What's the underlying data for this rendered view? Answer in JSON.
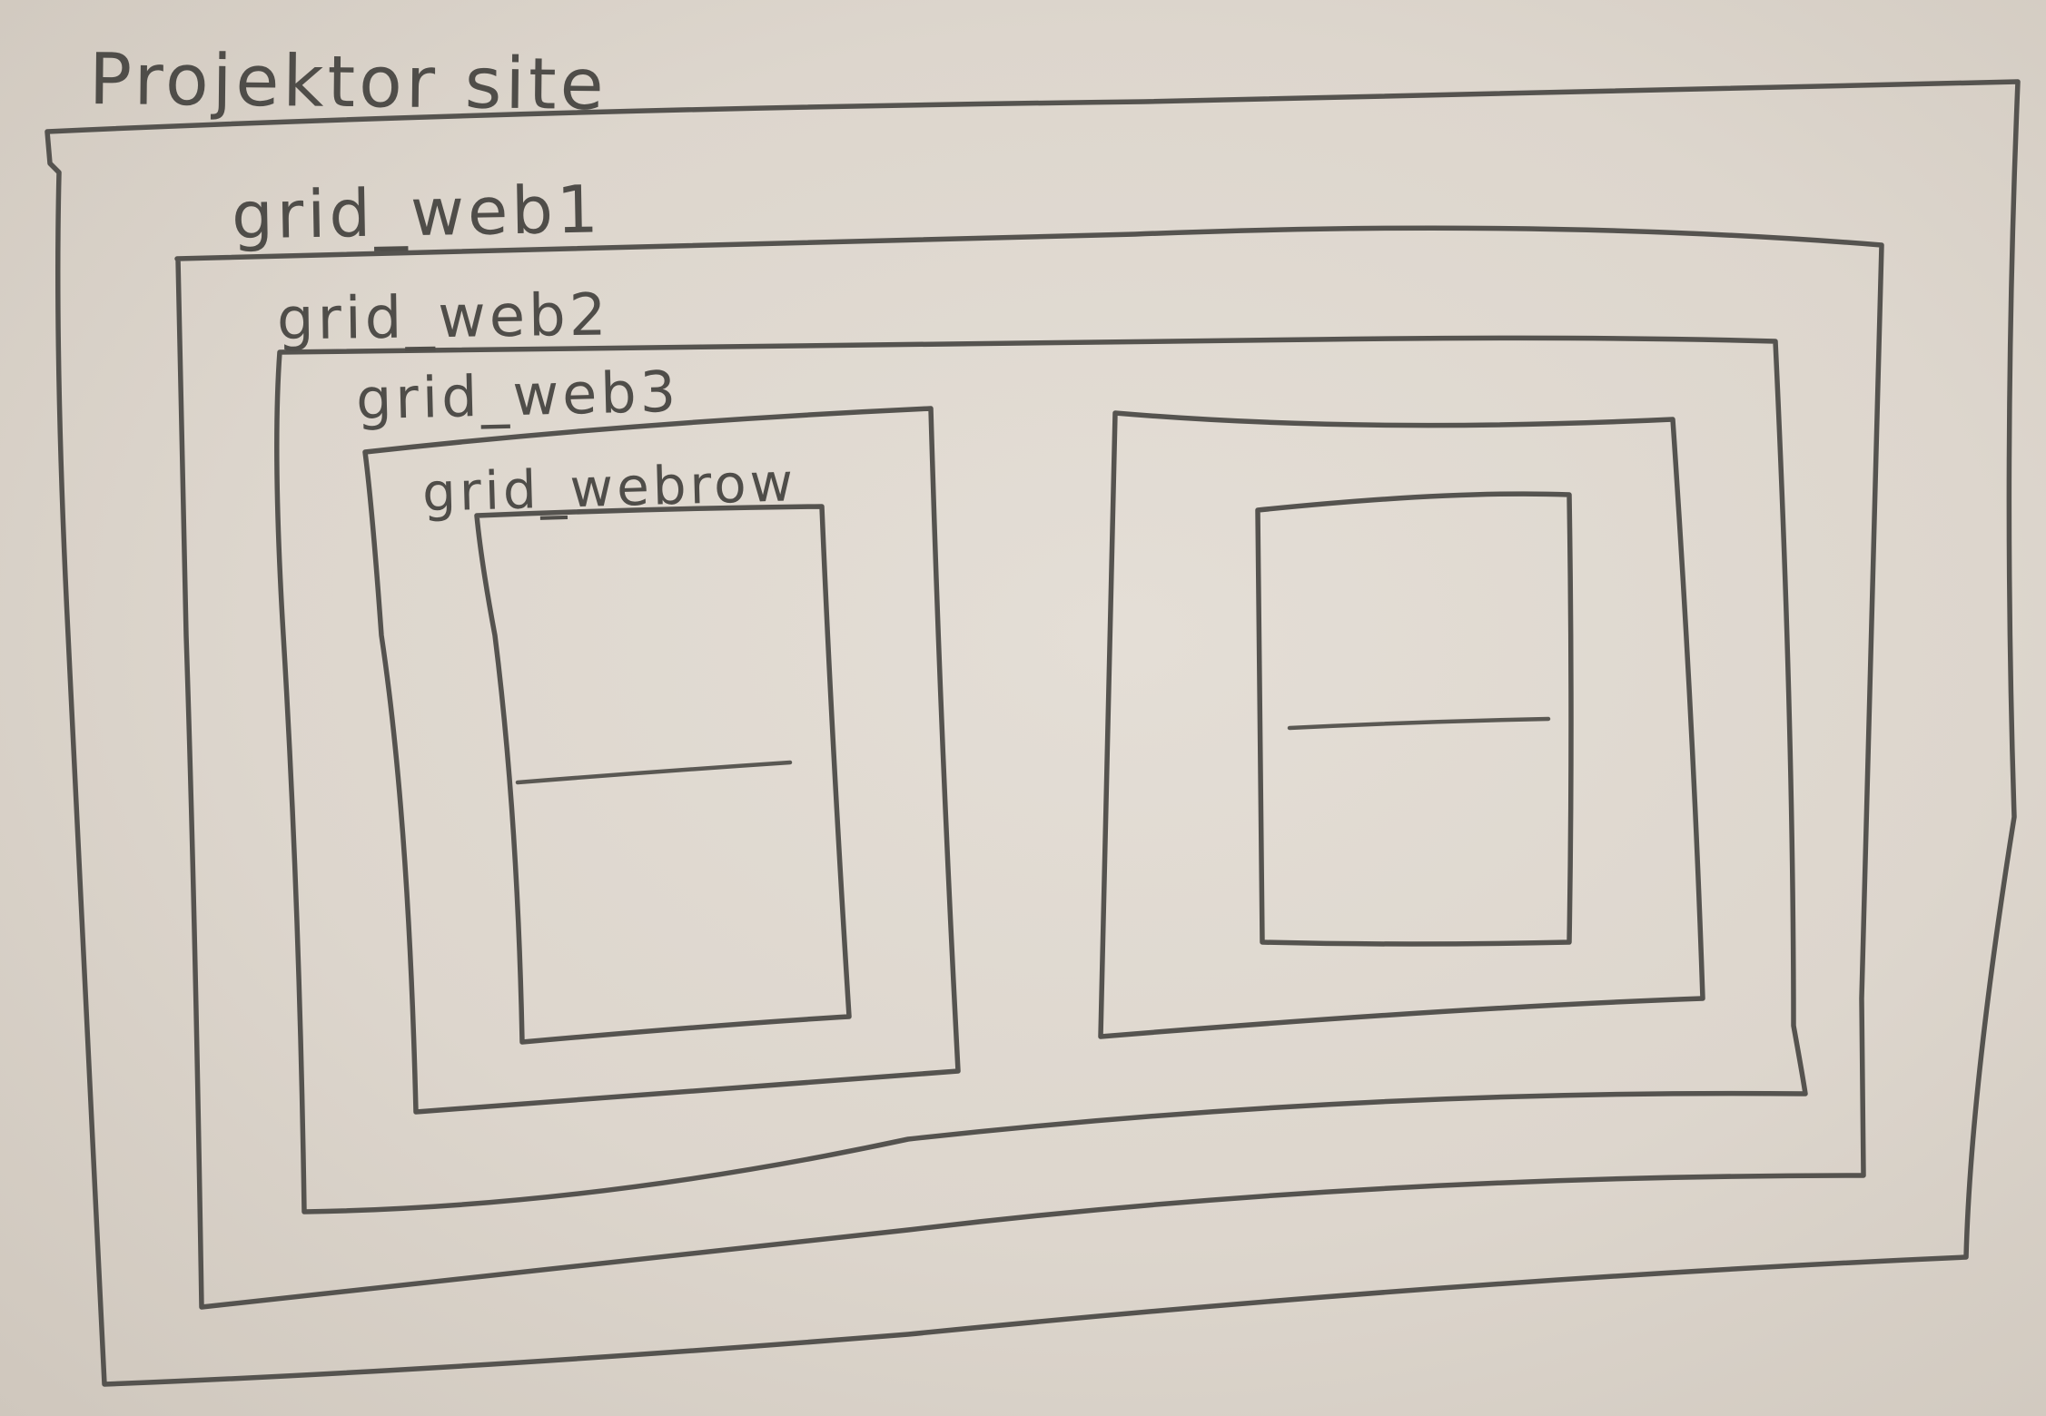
{
  "labels": {
    "site": "Projektor site",
    "web1": "grid_web1",
    "web2": "grid_web2",
    "web3": "grid_web3",
    "webrow": "grid_webrow"
  },
  "colors": {
    "paper": "#ddd6cd",
    "pencil": "#55534f"
  }
}
